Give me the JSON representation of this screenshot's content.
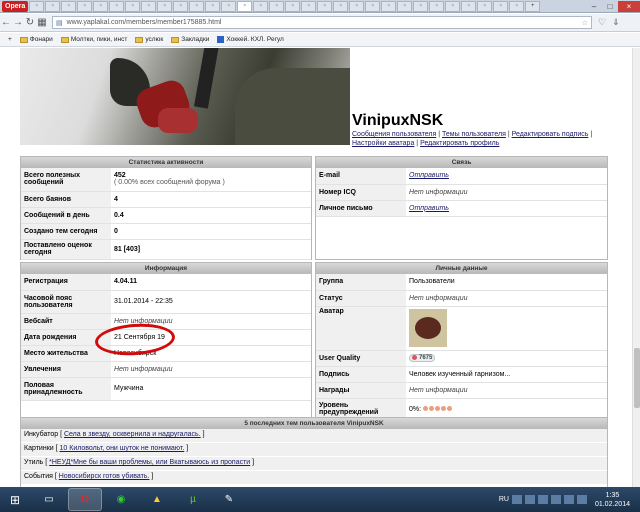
{
  "browser": {
    "menu_label": "Opera",
    "url": "www.yaplakal.com/members/member175885.html",
    "bookmarks": [
      "Фонари",
      "Молтки, пики, инст",
      "услюк",
      "Закладки",
      "Хоккей. КХЛ. Регул"
    ]
  },
  "profile": {
    "username": "VinipuxNSK",
    "links": [
      "Сообщения пользователя",
      "Темы пользователя",
      "Редактировать подпись",
      "Настройки аватара",
      "Редактировать профиль"
    ]
  },
  "activity": {
    "title": "Статистика активности",
    "rows": [
      {
        "label": "Всего полезных сообщений",
        "value": "452",
        "sub": "( 0.00% всех сообщений форума )"
      },
      {
        "label": "Всего баянов",
        "value": "4"
      },
      {
        "label": "Сообщений в день",
        "value": "0.4"
      },
      {
        "label": "Создано тем сегодня",
        "value": "0"
      },
      {
        "label": "Поставлено оценок сегодня",
        "value": "81 [403]"
      }
    ]
  },
  "contact": {
    "title": "Связь",
    "rows": [
      {
        "label": "E-mail",
        "value": "Отправить"
      },
      {
        "label": "Номер ICQ",
        "value": "Нет информации"
      },
      {
        "label": "Личное письмо",
        "value": "Отправить"
      }
    ]
  },
  "info": {
    "title": "Информация",
    "rows": [
      {
        "label": "Регистрация",
        "value": "4.04.11"
      },
      {
        "label": "Часовой пояс пользователя",
        "value": "31.01.2014 - 22:35"
      },
      {
        "label": "Вебсайт",
        "value": "Нет информации"
      },
      {
        "label": "Дата рождения",
        "value": "21 Сентября 19"
      },
      {
        "label": "Место жительства",
        "value": "Новосибирск"
      },
      {
        "label": "Увлечения",
        "value": "Нет информации"
      },
      {
        "label": "Половая принадлежность",
        "value": "Мужчина"
      }
    ]
  },
  "personal": {
    "title": "Личные данные",
    "rows": [
      {
        "label": "Группа",
        "value": "Пользователи"
      },
      {
        "label": "Статус",
        "value": "Нет информации"
      },
      {
        "label": "Аватар",
        "value": ""
      },
      {
        "label": "User Quality",
        "value": "7675"
      },
      {
        "label": "Подпись",
        "value": "Человек изученный гарнизом..."
      },
      {
        "label": "Награды",
        "value": "Нет информации"
      },
      {
        "label": "Уровень предупреждений",
        "value": "0%:"
      }
    ]
  },
  "recent": {
    "title": "5 последних тем пользователя VinipuxNSK",
    "items": [
      {
        "forum": "Инкубатор",
        "topic": "Села в звезду, осквернила и надругалась."
      },
      {
        "forum": "Картинки",
        "topic": "10 Киловольт, они шуток не понимают."
      },
      {
        "forum": "Утиль",
        "topic": "*НЕУД*Мне бы ваши проблемы, или Вкатываюсь из пропасти"
      },
      {
        "forum": "События",
        "topic": "Новосибирск готов убивать."
      }
    ]
  },
  "taskbar": {
    "lang": "RU",
    "time": "1:35",
    "date": "01.02.2014"
  }
}
